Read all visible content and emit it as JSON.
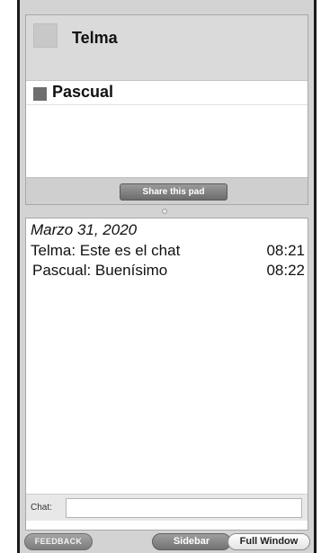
{
  "users": {
    "me": {
      "name": "Telma",
      "color": "#c8c8c8"
    },
    "others": [
      {
        "name": "Pascual",
        "color": "#6e6e6e"
      }
    ],
    "share_label": "Share this pad"
  },
  "chat": {
    "date": "Marzo 31, 2020",
    "messages": [
      {
        "text": "Telma: Este es el chat",
        "time": "08:21"
      },
      {
        "text": "Pascual: Buenísimo",
        "time": "08:22"
      }
    ],
    "input_label": "Chat:",
    "input_value": ""
  },
  "footer": {
    "feedback_label": "FEEDBACK",
    "sidebar_label": "Sidebar",
    "fullwindow_label": "Full Window"
  }
}
